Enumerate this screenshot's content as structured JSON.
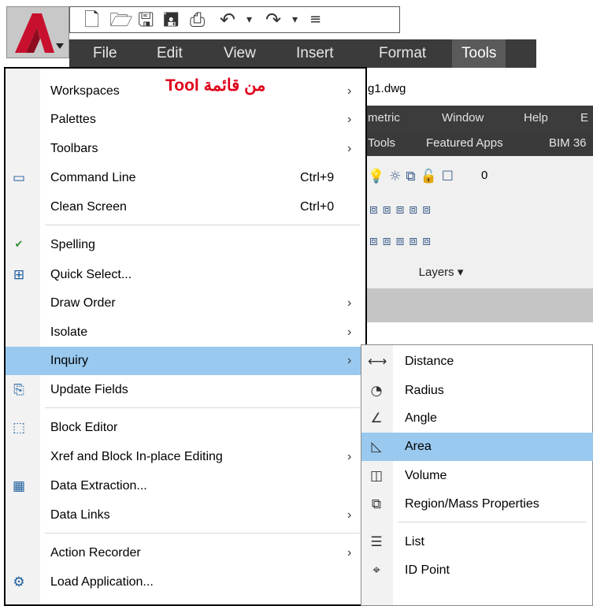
{
  "qat": {
    "app_button_icon": "autocad-logo-icon",
    "icons": [
      "new-icon",
      "open-icon",
      "save-icon",
      "save-as-icon",
      "print-icon",
      "undo-icon",
      "dropdown-icon",
      "redo-icon",
      "dropdown-icon",
      "customize-icon"
    ]
  },
  "menubar": {
    "items": [
      "File",
      "Edit",
      "View",
      "Insert",
      "Format",
      "Tools"
    ],
    "active": "Tools"
  },
  "background_window": {
    "doc_title": "g1.dwg",
    "menu_items": [
      "metric",
      "Window",
      "Help",
      "E"
    ],
    "ribbon_tabs": [
      "Tools",
      "Featured Apps",
      "BIM 36"
    ],
    "layer_value": "0",
    "panel_label": "Layers ▾"
  },
  "annotation": "من قائمة Tool",
  "tools_menu": {
    "items": [
      {
        "label": "Workspaces",
        "arrow": "›"
      },
      {
        "label": "Palettes",
        "arrow": "›"
      },
      {
        "label": "Toolbars",
        "arrow": "›"
      },
      {
        "label": "Command Line",
        "shortcut": "Ctrl+9",
        "icon": "command-line-icon"
      },
      {
        "label": "Clean Screen",
        "shortcut": "Ctrl+0"
      },
      {
        "label": "Spelling",
        "icon": "spelling-icon"
      },
      {
        "label": "Quick Select...",
        "icon": "quick-select-icon"
      },
      {
        "label": "Draw Order",
        "arrow": "›"
      },
      {
        "label": "Isolate",
        "arrow": "›"
      },
      {
        "label": "Inquiry",
        "arrow": "›",
        "highlighted": true
      },
      {
        "label": "Update Fields",
        "icon": "update-fields-icon"
      },
      {
        "label": "Block Editor",
        "icon": "block-editor-icon"
      },
      {
        "label": "Xref and Block In-place Editing",
        "arrow": "›"
      },
      {
        "label": "Data Extraction...",
        "icon": "data-extraction-icon"
      },
      {
        "label": "Data Links",
        "arrow": "›"
      },
      {
        "label": "Action Recorder",
        "arrow": "›"
      },
      {
        "label": "Load Application...",
        "icon": "load-application-icon"
      }
    ]
  },
  "inquiry_submenu": {
    "items": [
      {
        "label": "Distance",
        "icon": "distance-icon"
      },
      {
        "label": "Radius",
        "icon": "radius-icon"
      },
      {
        "label": "Angle",
        "icon": "angle-icon"
      },
      {
        "label": "Area",
        "icon": "area-icon",
        "highlighted": true
      },
      {
        "label": "Volume",
        "icon": "volume-icon"
      },
      {
        "label": "Region/Mass Properties",
        "icon": "region-mass-properties-icon"
      },
      {
        "label": "List",
        "icon": "list-icon"
      },
      {
        "label": "ID Point",
        "icon": "id-point-icon"
      }
    ]
  },
  "colors": {
    "highlight": "#99c9ef",
    "menubar": "#3b3b3b",
    "annotation": "#e0001a",
    "logo": "#c8102e"
  }
}
